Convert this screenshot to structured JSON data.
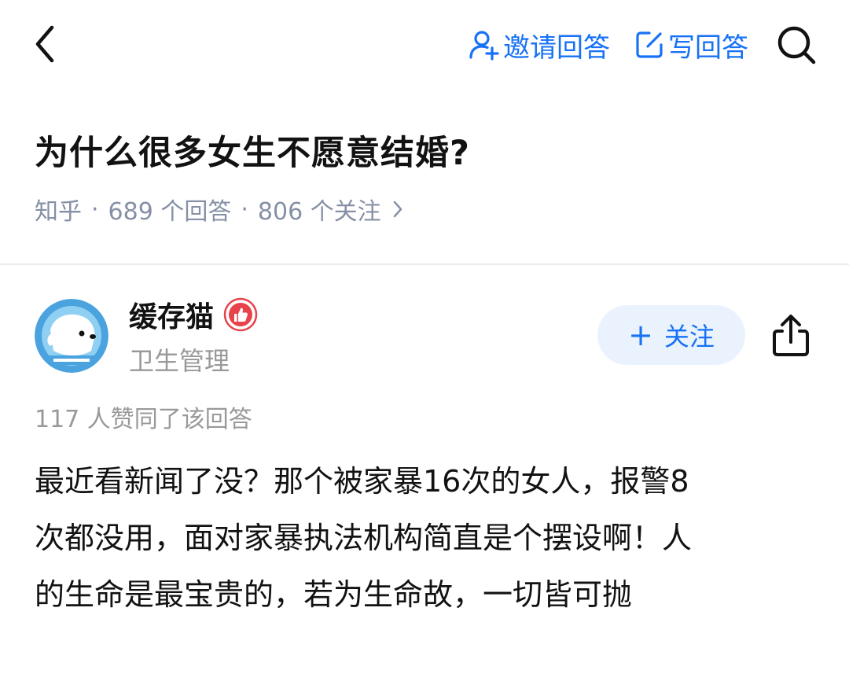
{
  "topbar": {
    "invite_label": "邀请回答",
    "write_label": "写回答"
  },
  "question": {
    "title": "为什么很多女生不愿意结婚?",
    "source": "知乎",
    "answers_count": "689 个回答",
    "followers_count": "806 个关注"
  },
  "author": {
    "name": "缓存猫",
    "tagline": "卫生管理",
    "follow_label": "关注"
  },
  "answer": {
    "upvote_summary": "117 人赞同了该回答",
    "lines": [
      "最近看新闻了没？那个被家暴16次的女人，报警8",
      "次都没用，面对家暴执法机构简直是个摆设啊！人",
      "的生命是最宝贵的，若为生命故，一切皆可抛"
    ]
  },
  "colors": {
    "accent": "#1772f6",
    "follow_bg": "#eaf2fe",
    "meta_gray": "#8590a6",
    "text_primary": "#121212",
    "text_secondary": "#999999",
    "badge_red": "#e8424b",
    "avatar_bg": "#4aa3df"
  },
  "icons": {
    "back": "chevron-left-icon",
    "invite": "user-plus-icon",
    "write": "edit-icon",
    "search": "search-icon",
    "meta_more": "chevron-right-icon",
    "badge": "thumbs-up-badge-icon",
    "share": "share-icon"
  }
}
